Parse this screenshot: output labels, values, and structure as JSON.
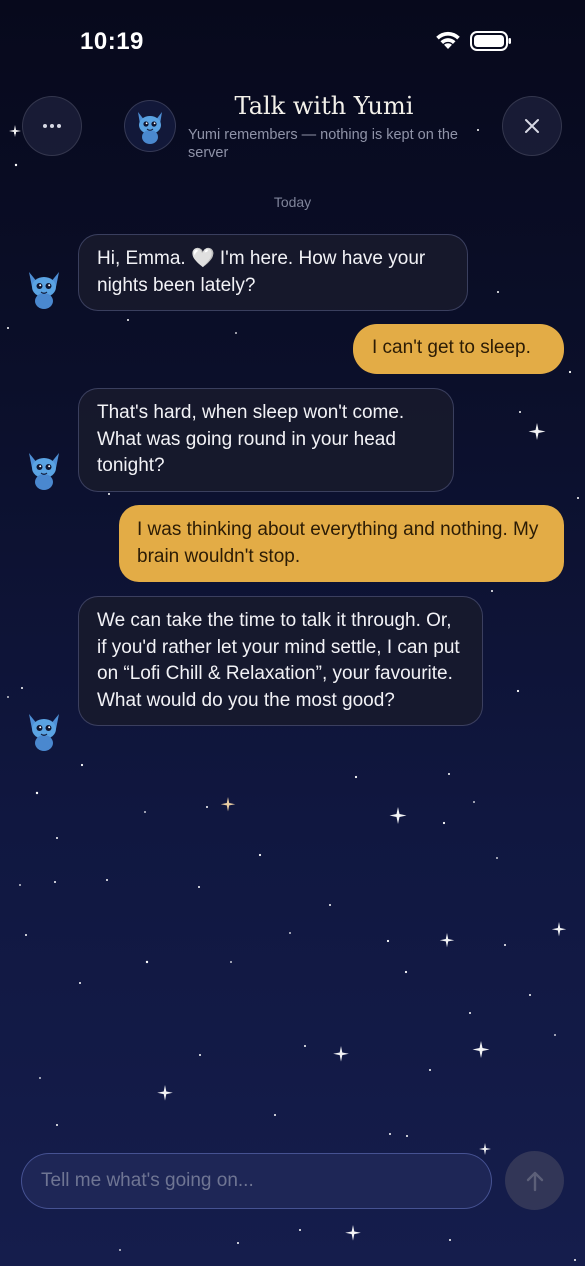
{
  "status_bar": {
    "time": "10:19"
  },
  "header": {
    "title": "Talk with Yumi",
    "subtitle": "Yumi remembers — nothing is kept on the server"
  },
  "date_separator": "Today",
  "messages": [
    {
      "role": "assistant",
      "text": "Hi, Emma. 🤍 I'm here. How have your nights been lately?"
    },
    {
      "role": "user",
      "text": "I can't get to sleep."
    },
    {
      "role": "assistant",
      "text": "That's hard, when sleep won't come. What was going round in your head tonight?"
    },
    {
      "role": "user",
      "text": "I was thinking about everything and nothing. My brain wouldn't stop."
    },
    {
      "role": "assistant",
      "text": "We can take the time to talk it through. Or, if you'd rather let your mind settle, I can put on “Lofi Chill & Relaxation”, your favourite. What would do you the most good?"
    }
  ],
  "composer": {
    "placeholder": "Tell me what's going on..."
  },
  "colors": {
    "user_bubble": "#e3ac46",
    "assistant_bubble": "#181a2c",
    "background": "#0b0f2a"
  },
  "icons": {
    "menu": "ellipsis-icon",
    "close": "close-icon",
    "send": "arrow-up-icon",
    "avatar": "yumi-creature-icon"
  }
}
